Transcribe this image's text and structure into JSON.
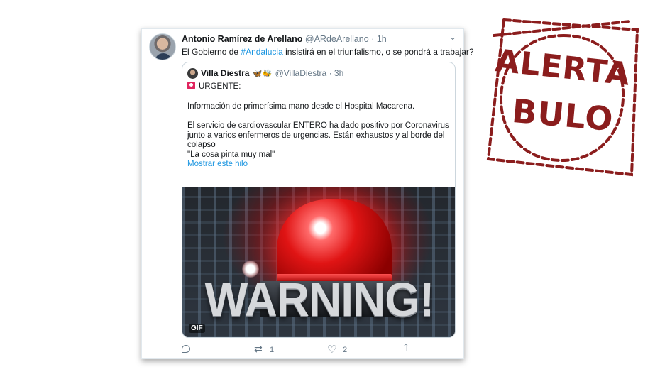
{
  "tweet": {
    "author_name": "Antonio Ramírez de Arellano",
    "author_handle": "@ARdeArellano",
    "separator": "·",
    "time": "1h",
    "text_before": "El Gobierno de ",
    "hashtag": "#Andalucia",
    "text_after": " insistirá en el triunfalismo, o se pondrá a trabajar?"
  },
  "quoted": {
    "author_name": "Villa Diestra",
    "emojis": "🦋🐝",
    "handle": "@VillaDiestra",
    "separator": "·",
    "time": "3h",
    "lines": {
      "urgent": "URGENTE:",
      "info": "Información de primerísima mano desde el Hospital Macarena.",
      "p1": "El servicio de cardiovascular ENTERO ha dado positivo por Coronavirus",
      "p2": "junto a varios enfermeros de urgencias. Están exhaustos y al borde del",
      "p3": "colapso",
      "quote": "\"La cosa pinta muy mal\""
    },
    "show_thread": "Mostrar este hilo",
    "gif_text": "WARNING!",
    "gif_badge": "GIF"
  },
  "actions": {
    "retweet_count": "1",
    "like_count": "2"
  },
  "stamp": {
    "line1": "ALERTA",
    "line2": "BULO",
    "color": "#8b1d1d"
  },
  "icons": [
    "chevron-down-icon",
    "reply-icon",
    "retweet-icon",
    "like-icon",
    "share-icon",
    "siren-emoji-icon"
  ]
}
